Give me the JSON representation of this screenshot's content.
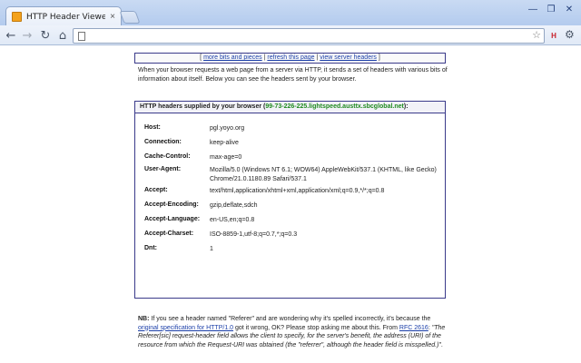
{
  "browser": {
    "tab_title": "HTTP Header Viewer: list b",
    "tab_close": "×",
    "window_controls": {
      "minimize": "—",
      "maximize": "❐",
      "close": "✕"
    },
    "url": "",
    "ext_label": "H"
  },
  "page": {
    "nav": {
      "bracket_open": "[",
      "sep": "|",
      "bracket_close": "]",
      "links": [
        "more bits and pieces",
        "refresh this page",
        "view server headers"
      ]
    },
    "intro": "When your browser requests a web page from a server via HTTP, it sends a set of headers with various bits of information about itself. Below you can see the headers sent by your browser.",
    "headers_box": {
      "title_prefix": "HTTP headers supplied by your browser (",
      "ip": "99-73-226-225.lightspeed.austtx.sbcglobal.net",
      "title_suffix": "):",
      "rows": [
        {
          "name": "Host:",
          "value": "pgl.yoyo.org"
        },
        {
          "name": "Connection:",
          "value": "keep-alive"
        },
        {
          "name": "Cache-Control:",
          "value": "max-age=0"
        },
        {
          "name": "User-Agent:",
          "value": "Mozilla/5.0 (Windows NT 6.1; WOW64) AppleWebKit/537.1 (KHTML, like Gecko) Chrome/21.0.1180.89 Safari/537.1"
        },
        {
          "name": "Accept:",
          "value": "text/html,application/xhtml+xml,application/xml;q=0.9,*/*;q=0.8"
        },
        {
          "name": "Accept-Encoding:",
          "value": "gzip,deflate,sdch"
        },
        {
          "name": "Accept-Language:",
          "value": "en-US,en;q=0.8"
        },
        {
          "name": "Accept-Charset:",
          "value": "ISO-8859-1,utf-8;q=0.7,*;q=0.3"
        },
        {
          "name": "Dnt:",
          "value": "1"
        }
      ]
    },
    "nb": {
      "label": "NB:",
      "text1": " If you see a header named \"Referer\" and are wondering why it's spelled incorrectly, it's because the ",
      "link1": "original specification for HTTP/1.0",
      "text2": " got it wrong, OK? Please stop asking me about this. From ",
      "link2": "RFC 2616",
      "text3": ": ",
      "quote": "\"The Referer[sic] request-header field allows the client to specify, for the server's benefit, the address (URI) of the resource from which the Request-URI was obtained (the \"referrer\", although the header field is misspelled.)\"",
      "text4": "."
    }
  },
  "colors": {
    "ip_green": "#1f8a1f",
    "link_blue": "#1a3ea8",
    "highlight_yellow": "#f7ef1a",
    "box_border": "#3a3a8a"
  }
}
